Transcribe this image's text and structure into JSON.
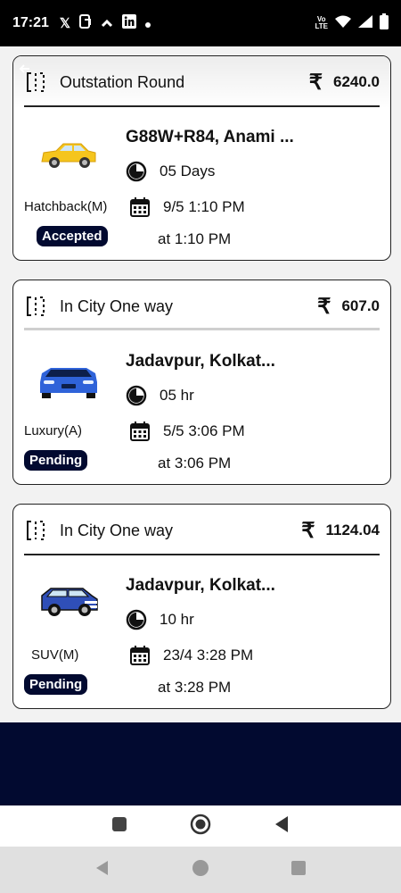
{
  "status_bar": {
    "time": "17:21",
    "volte_top": "Vo",
    "volte_bottom": "LTE"
  },
  "bookings": [
    {
      "trip_type": "Outstation Round",
      "price": "6240.0",
      "address": "G88W+R84, Anami ...",
      "duration": "05 Days",
      "car_type": "Hatchback(M)",
      "date": "9/5 1:10 PM",
      "status": "Accepted",
      "time_label": "at  1:10 PM",
      "car_color": "#f5c51d"
    },
    {
      "trip_type": "In City One way",
      "price": "607.0",
      "address": "Jadavpur, Kolkat...",
      "duration": "05 hr",
      "car_type": "Luxury(A)",
      "date": "5/5 3:06 PM",
      "status": "Pending",
      "time_label": "at  3:06 PM",
      "car_color": "#2f63d9"
    },
    {
      "trip_type": "In City One way",
      "price": "1124.04",
      "address": "Jadavpur, Kolkat...",
      "duration": "10 hr",
      "car_type": "SUV(M)",
      "date": "23/4 3:28 PM",
      "status": "Pending",
      "time_label": "at  3:28 PM",
      "car_color": "#2f4fb8"
    }
  ],
  "icons": {
    "trip": "route-icon",
    "duration": "timer-icon",
    "date": "calendar-icon",
    "back": "back-arrow-icon"
  },
  "colors": {
    "badge": "#020a30",
    "panel": "#020a30"
  }
}
